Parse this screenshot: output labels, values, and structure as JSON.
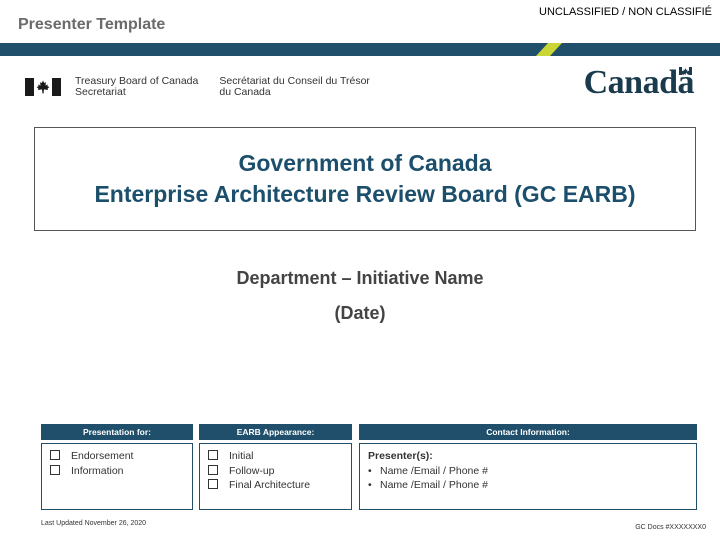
{
  "header": {
    "classification": "UNCLASSIFIED / NON CLASSIFIÉ",
    "template_title": "Presenter Template",
    "band_colors": {
      "primary": "#1f4f6a",
      "accent": "#c9d636"
    }
  },
  "logo": {
    "flag_icon": "canada-flag-icon",
    "dept_en_line1": "Treasury Board of Canada",
    "dept_en_line2": "Secretariat",
    "dept_fr_line1": "Secrétariat du Conseil du Trésor",
    "dept_fr_line2": "du Canada",
    "wordmark": "Canadä"
  },
  "title": {
    "line1": "Government of Canada",
    "line2": "Enterprise Architecture Review Board (GC EARB)"
  },
  "subtitle": {
    "line1": "Department – Initiative Name",
    "line2": "(Date)"
  },
  "panels": {
    "presentation": {
      "header": "Presentation for:",
      "items": [
        "Endorsement",
        "Information"
      ]
    },
    "appearance": {
      "header": "EARB Appearance:",
      "items": [
        "Initial",
        "Follow-up",
        "Final Architecture"
      ]
    },
    "contact": {
      "header": "Contact Information:",
      "presenter_label": "Presenter(s):",
      "items": [
        "Name /Email / Phone #",
        "Name /Email / Phone #"
      ]
    }
  },
  "footer": {
    "last_updated": "Last Updated  November 26, 2020",
    "doc_ref": "GC Docs #XXXXXXX0"
  }
}
